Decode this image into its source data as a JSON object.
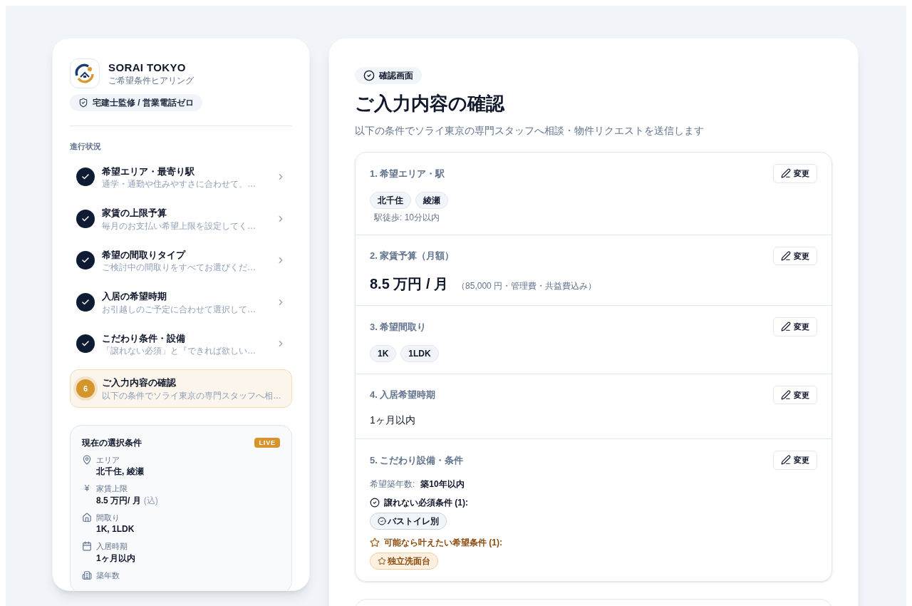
{
  "brand": {
    "name": "SORAI TOKYO",
    "subtitle": "ご希望条件ヒアリング",
    "badge": "宅建士監修 / 営業電話ゼロ"
  },
  "progress": {
    "label": "進行状況",
    "steps": [
      {
        "title": "希望エリア・最寄り駅",
        "description": "通学・通勤や住みやすさに合わせて、…",
        "kind": "done",
        "selected": false
      },
      {
        "title": "家賃の上限予算",
        "description": "毎月のお支払い希望上限を設定してく…",
        "kind": "done",
        "selected": false
      },
      {
        "title": "希望の間取りタイプ",
        "description": "ご検討中の間取りをすべてお選びくだ…",
        "kind": "done",
        "selected": false
      },
      {
        "title": "入居の希望時期",
        "description": "お引越しのご予定に合わせて選択して…",
        "kind": "done",
        "selected": false
      },
      {
        "title": "こだわり条件・設備",
        "description": "「譲れない必須」と『できれば欲しい…",
        "kind": "done",
        "selected": false
      },
      {
        "title": "ご入力内容の確認",
        "description": "以下の条件でソライ東京の専門スタッフへ相…",
        "kind": "current",
        "number": "6",
        "selected": true
      }
    ]
  },
  "summary": {
    "title": "現在の選択条件",
    "badge": "LIVE",
    "items": [
      {
        "kind": "area",
        "label": "エリア",
        "value": "北千住, 綾瀬"
      },
      {
        "kind": "rent",
        "icon_text": "¥",
        "label": "家賃上限",
        "value": "8.5 万円/ 月",
        "note": "(込)"
      },
      {
        "kind": "layout",
        "label": "間取り",
        "value": "1K, 1LDK"
      },
      {
        "kind": "move",
        "label": "入居時期",
        "value": "1ヶ月以内"
      },
      {
        "kind": "age",
        "label": "築年数"
      }
    ]
  },
  "main": {
    "badge": "確認画面",
    "title": "ご入力内容の確認",
    "subtitle": "以下の条件でソライ東京の専門スタッフへ相談・物件リクエストを送信します",
    "sections": [
      {
        "kind": "tags",
        "title": "1. 希望エリア・駅",
        "edit": "変更",
        "tags": [
          "北千住",
          "綾瀬"
        ],
        "note": "駅徒歩: 10分以内"
      },
      {
        "kind": "price",
        "title": "2. 家賃予算（月額）",
        "edit": "変更",
        "value": "8.5 万円 / 月",
        "note": "（85,000 円・管理費・共益費込み）"
      },
      {
        "kind": "tags",
        "title": "3. 希望間取り",
        "edit": "変更",
        "tags": [
          "1K",
          "1LDK"
        ]
      },
      {
        "kind": "text",
        "title": "4. 入居希望時期",
        "edit": "変更",
        "value": "1ヶ月以内"
      },
      {
        "kind": "features",
        "title": "5. こだわり設備・条件",
        "edit": "変更",
        "age_label": "希望築年数:",
        "age_value": "築10年以内",
        "groups": [
          {
            "kind": "must",
            "label": "譲れない必須条件 (1):",
            "items": [
              "バストイレ別"
            ]
          },
          {
            "kind": "wish",
            "label": "可能なら叶えたい希望条件 (1):",
            "items": [
              "独立洗面台"
            ]
          }
        ]
      }
    ]
  }
}
